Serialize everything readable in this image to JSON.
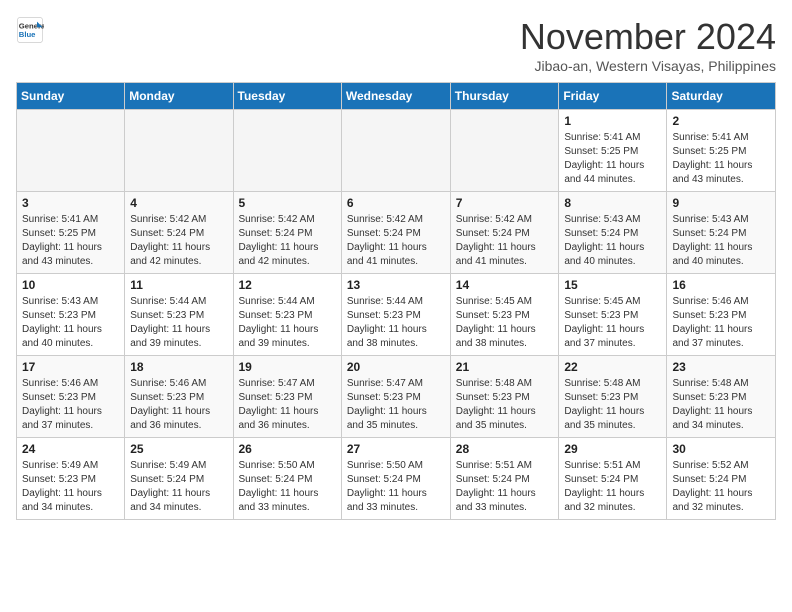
{
  "header": {
    "logo_line1": "General",
    "logo_line2": "Blue",
    "month_title": "November 2024",
    "subtitle": "Jibao-an, Western Visayas, Philippines"
  },
  "days_of_week": [
    "Sunday",
    "Monday",
    "Tuesday",
    "Wednesday",
    "Thursday",
    "Friday",
    "Saturday"
  ],
  "weeks": [
    [
      {
        "day": "",
        "info": ""
      },
      {
        "day": "",
        "info": ""
      },
      {
        "day": "",
        "info": ""
      },
      {
        "day": "",
        "info": ""
      },
      {
        "day": "",
        "info": ""
      },
      {
        "day": "1",
        "info": "Sunrise: 5:41 AM\nSunset: 5:25 PM\nDaylight: 11 hours and 44 minutes."
      },
      {
        "day": "2",
        "info": "Sunrise: 5:41 AM\nSunset: 5:25 PM\nDaylight: 11 hours and 43 minutes."
      }
    ],
    [
      {
        "day": "3",
        "info": "Sunrise: 5:41 AM\nSunset: 5:25 PM\nDaylight: 11 hours and 43 minutes."
      },
      {
        "day": "4",
        "info": "Sunrise: 5:42 AM\nSunset: 5:24 PM\nDaylight: 11 hours and 42 minutes."
      },
      {
        "day": "5",
        "info": "Sunrise: 5:42 AM\nSunset: 5:24 PM\nDaylight: 11 hours and 42 minutes."
      },
      {
        "day": "6",
        "info": "Sunrise: 5:42 AM\nSunset: 5:24 PM\nDaylight: 11 hours and 41 minutes."
      },
      {
        "day": "7",
        "info": "Sunrise: 5:42 AM\nSunset: 5:24 PM\nDaylight: 11 hours and 41 minutes."
      },
      {
        "day": "8",
        "info": "Sunrise: 5:43 AM\nSunset: 5:24 PM\nDaylight: 11 hours and 40 minutes."
      },
      {
        "day": "9",
        "info": "Sunrise: 5:43 AM\nSunset: 5:24 PM\nDaylight: 11 hours and 40 minutes."
      }
    ],
    [
      {
        "day": "10",
        "info": "Sunrise: 5:43 AM\nSunset: 5:23 PM\nDaylight: 11 hours and 40 minutes."
      },
      {
        "day": "11",
        "info": "Sunrise: 5:44 AM\nSunset: 5:23 PM\nDaylight: 11 hours and 39 minutes."
      },
      {
        "day": "12",
        "info": "Sunrise: 5:44 AM\nSunset: 5:23 PM\nDaylight: 11 hours and 39 minutes."
      },
      {
        "day": "13",
        "info": "Sunrise: 5:44 AM\nSunset: 5:23 PM\nDaylight: 11 hours and 38 minutes."
      },
      {
        "day": "14",
        "info": "Sunrise: 5:45 AM\nSunset: 5:23 PM\nDaylight: 11 hours and 38 minutes."
      },
      {
        "day": "15",
        "info": "Sunrise: 5:45 AM\nSunset: 5:23 PM\nDaylight: 11 hours and 37 minutes."
      },
      {
        "day": "16",
        "info": "Sunrise: 5:46 AM\nSunset: 5:23 PM\nDaylight: 11 hours and 37 minutes."
      }
    ],
    [
      {
        "day": "17",
        "info": "Sunrise: 5:46 AM\nSunset: 5:23 PM\nDaylight: 11 hours and 37 minutes."
      },
      {
        "day": "18",
        "info": "Sunrise: 5:46 AM\nSunset: 5:23 PM\nDaylight: 11 hours and 36 minutes."
      },
      {
        "day": "19",
        "info": "Sunrise: 5:47 AM\nSunset: 5:23 PM\nDaylight: 11 hours and 36 minutes."
      },
      {
        "day": "20",
        "info": "Sunrise: 5:47 AM\nSunset: 5:23 PM\nDaylight: 11 hours and 35 minutes."
      },
      {
        "day": "21",
        "info": "Sunrise: 5:48 AM\nSunset: 5:23 PM\nDaylight: 11 hours and 35 minutes."
      },
      {
        "day": "22",
        "info": "Sunrise: 5:48 AM\nSunset: 5:23 PM\nDaylight: 11 hours and 35 minutes."
      },
      {
        "day": "23",
        "info": "Sunrise: 5:48 AM\nSunset: 5:23 PM\nDaylight: 11 hours and 34 minutes."
      }
    ],
    [
      {
        "day": "24",
        "info": "Sunrise: 5:49 AM\nSunset: 5:23 PM\nDaylight: 11 hours and 34 minutes."
      },
      {
        "day": "25",
        "info": "Sunrise: 5:49 AM\nSunset: 5:24 PM\nDaylight: 11 hours and 34 minutes."
      },
      {
        "day": "26",
        "info": "Sunrise: 5:50 AM\nSunset: 5:24 PM\nDaylight: 11 hours and 33 minutes."
      },
      {
        "day": "27",
        "info": "Sunrise: 5:50 AM\nSunset: 5:24 PM\nDaylight: 11 hours and 33 minutes."
      },
      {
        "day": "28",
        "info": "Sunrise: 5:51 AM\nSunset: 5:24 PM\nDaylight: 11 hours and 33 minutes."
      },
      {
        "day": "29",
        "info": "Sunrise: 5:51 AM\nSunset: 5:24 PM\nDaylight: 11 hours and 32 minutes."
      },
      {
        "day": "30",
        "info": "Sunrise: 5:52 AM\nSunset: 5:24 PM\nDaylight: 11 hours and 32 minutes."
      }
    ]
  ]
}
